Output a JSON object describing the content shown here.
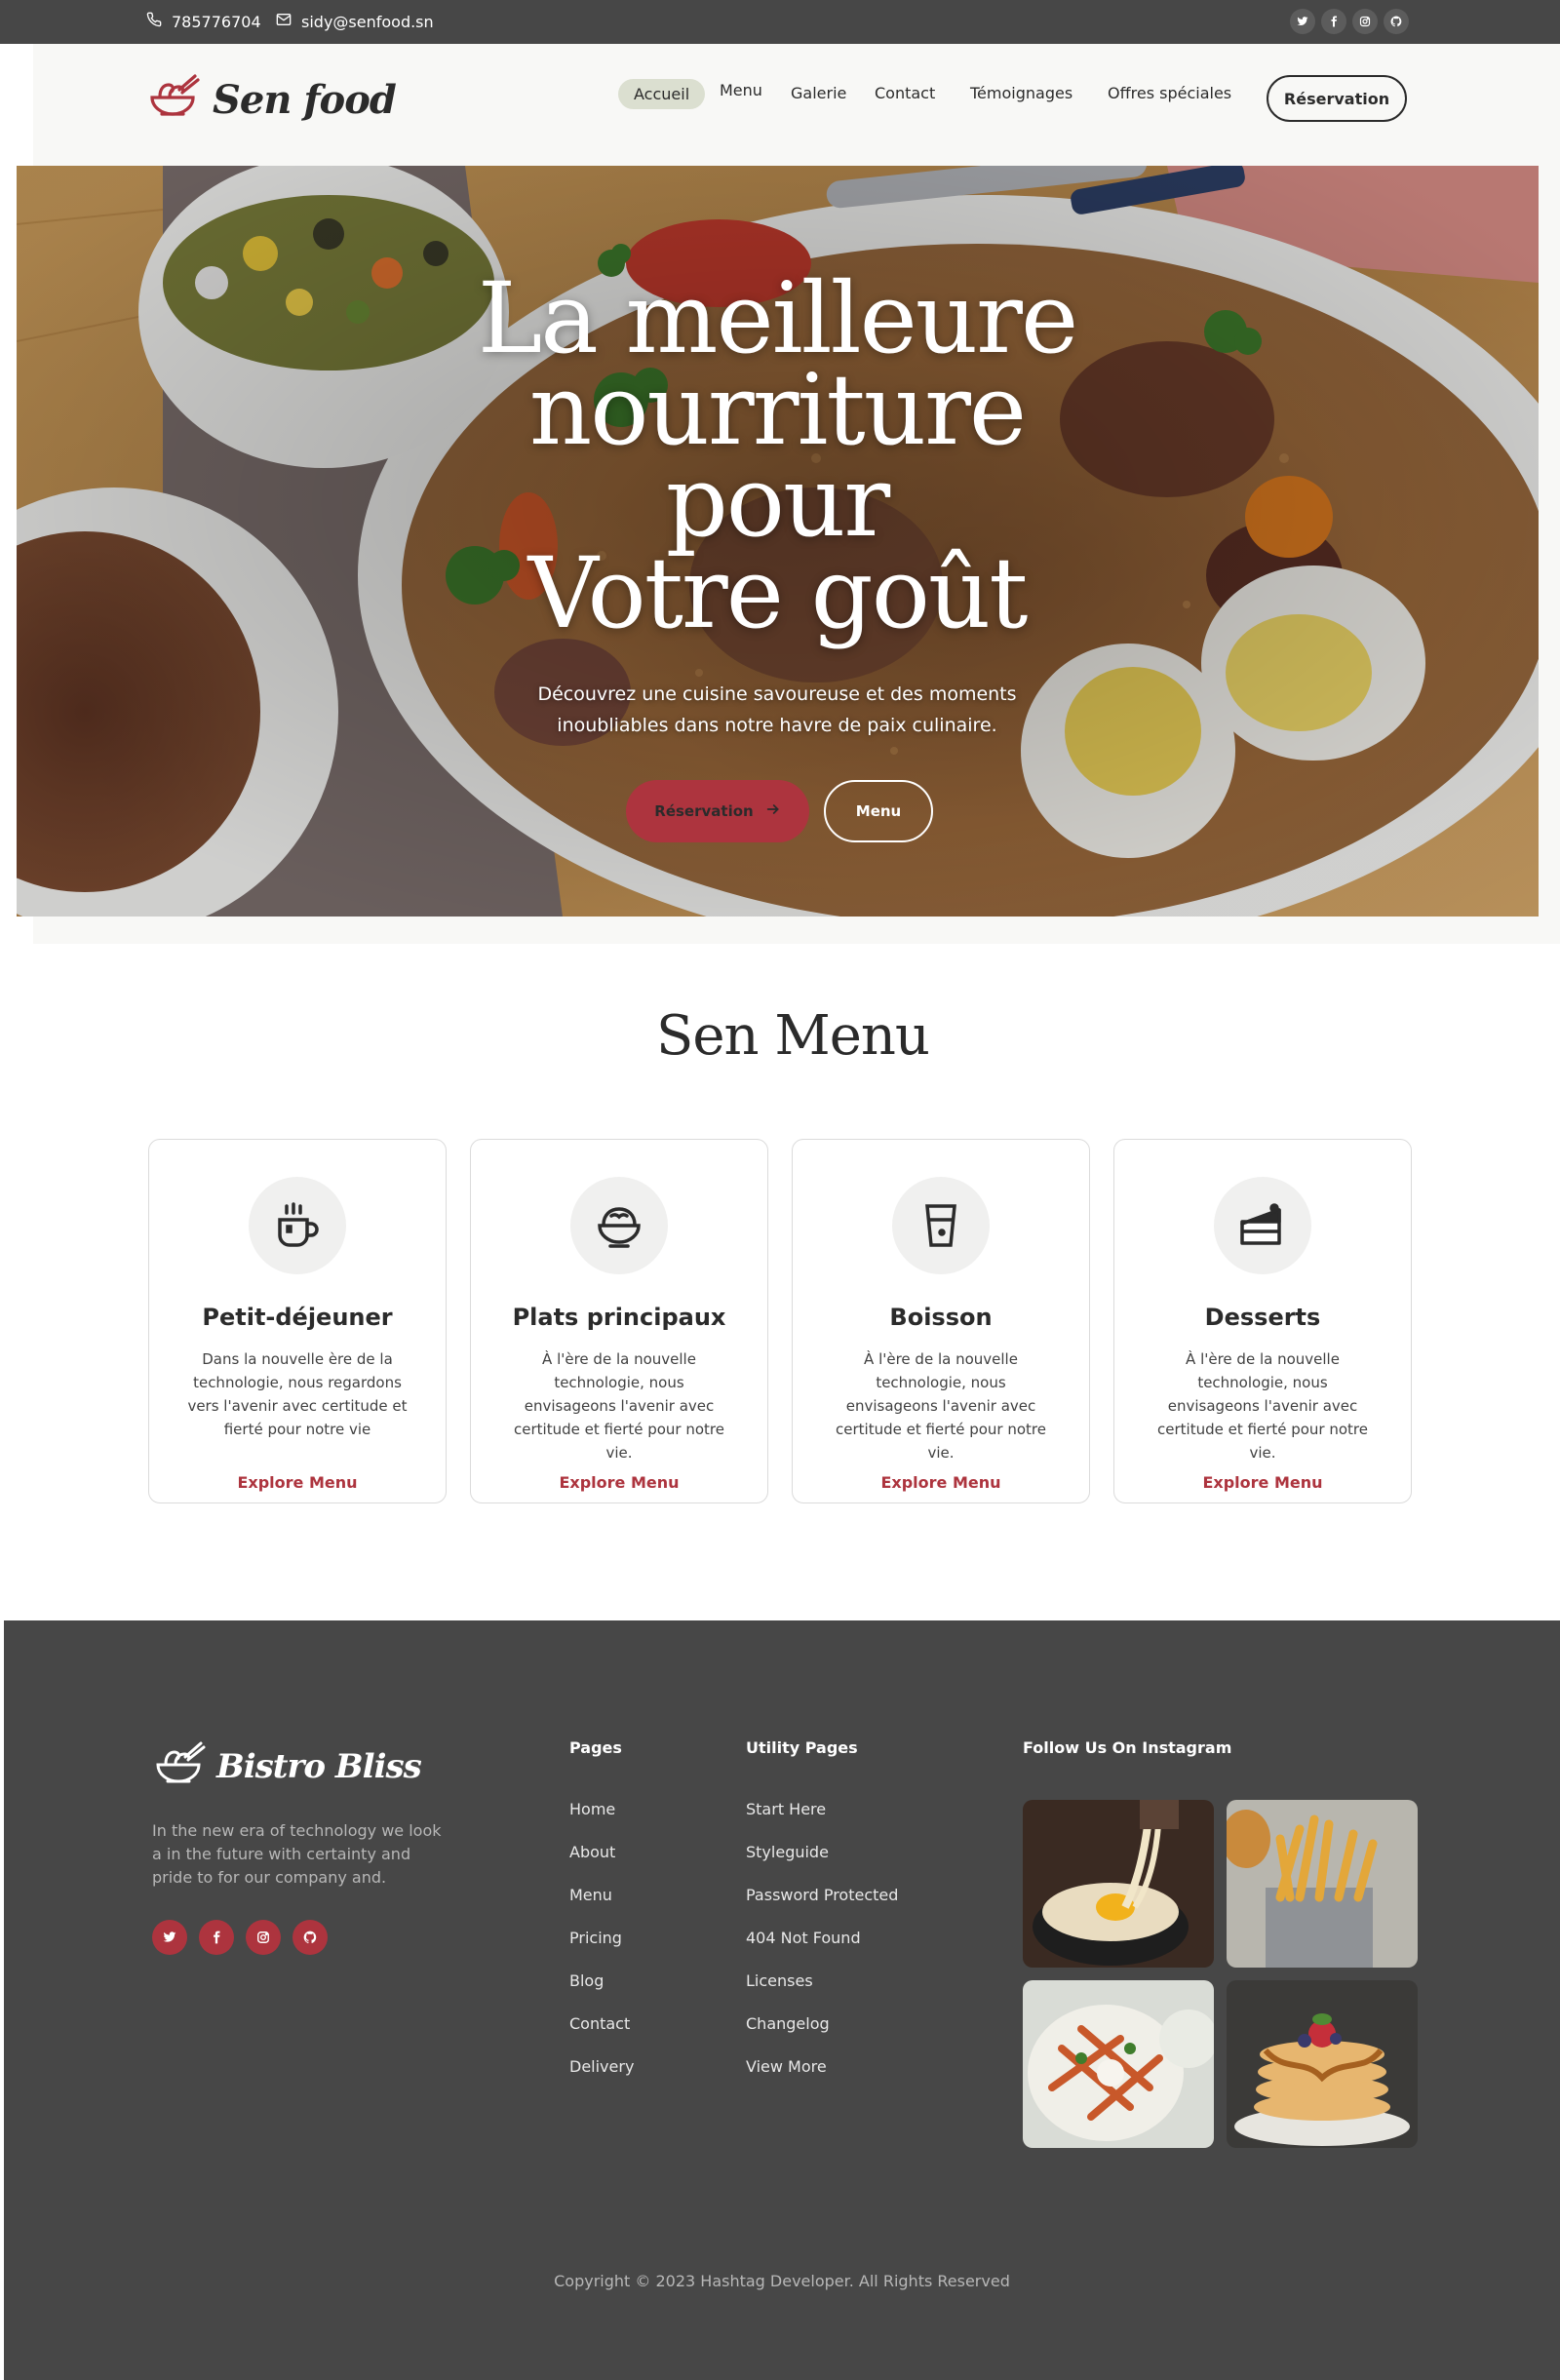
{
  "topbar": {
    "phone": "785776704",
    "email": "sidy@senfood.sn",
    "socials": [
      "twitter-icon",
      "facebook-icon",
      "instagram-icon",
      "github-icon"
    ]
  },
  "header": {
    "logo_text": "Sen food",
    "nav": [
      "Accueil",
      "Menu",
      "Galerie",
      "Contact",
      "Témoignages",
      "Offres spéciales"
    ],
    "active_nav": "Accueil",
    "reserve_label": "Réservation"
  },
  "hero": {
    "title_lines": [
      "La meilleure",
      "nourriture",
      "pour",
      "Votre goût"
    ],
    "subtitle": "Découvrez une cuisine savoureuse et des moments inoubliables dans notre havre de paix culinaire.",
    "primary_button": "Réservation",
    "secondary_button": "Menu"
  },
  "menu": {
    "title": "Sen Menu",
    "cards": [
      {
        "icon": "coffee-cup-icon",
        "title": "Petit-déjeuner",
        "desc": "Dans la nouvelle ère de la technologie, nous regardons vers l'avenir avec certitude et fierté pour notre vie",
        "link": "Explore Menu"
      },
      {
        "icon": "food-bowl-icon",
        "title": "Plats principaux",
        "desc": "À l'ère de la nouvelle technologie, nous envisageons l'avenir avec certitude et fierté pour notre vie.",
        "link": "Explore Menu"
      },
      {
        "icon": "drink-glass-icon",
        "title": "Boisson",
        "desc": "À l'ère de la nouvelle technologie, nous envisageons l'avenir avec certitude et fierté pour notre vie.",
        "link": "Explore Menu"
      },
      {
        "icon": "cake-slice-icon",
        "title": "Desserts",
        "desc": "À l'ère de la nouvelle technologie, nous envisageons l'avenir avec certitude et fierté pour notre vie.",
        "link": "Explore Menu"
      }
    ]
  },
  "footer": {
    "logo_text": "Bistro Bliss",
    "description": "In the new era of technology we look a in the future with certainty and pride to for our company and.",
    "socials": [
      "twitter-icon",
      "facebook-icon",
      "instagram-icon",
      "github-icon"
    ],
    "pages_title": "Pages",
    "pages": [
      "Home",
      "About",
      "Menu",
      "Pricing",
      "Blog",
      "Contact",
      "Delivery"
    ],
    "utility_title": "Utility Pages",
    "utility": [
      "Start Here",
      "Styleguide",
      "Password Protected",
      "404 Not Found",
      "Licenses",
      "Changelog",
      "View More"
    ],
    "instagram_title": "Follow Us On Instagram",
    "instagram_images": [
      "noodle-bowl-photo",
      "french-fries-photo",
      "fries-salad-photo",
      "pancakes-photo"
    ],
    "copyright": "Copyright © 2023 Hashtag Developer. All Rights Reserved"
  },
  "colors": {
    "accent": "#ad343e",
    "dark": "#474747",
    "text": "#2b2b2b",
    "header_bg": "#f8f8f6"
  }
}
